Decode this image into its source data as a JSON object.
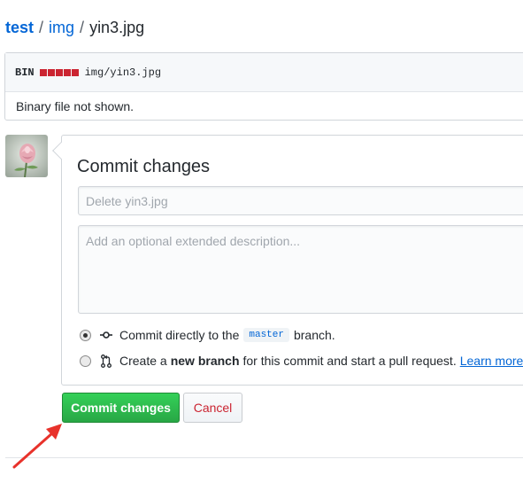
{
  "breadcrumb": {
    "root": "test",
    "folder": "img",
    "file": "yin3.jpg",
    "separator": "/"
  },
  "file": {
    "type_label": "BIN",
    "path": "img/yin3.jpg",
    "body_text": "Binary file not shown.",
    "diffstat_color": "#cb2431"
  },
  "commit": {
    "title": "Commit changes",
    "summary_placeholder": "Delete yin3.jpg",
    "description_placeholder": "Add an optional extended description...",
    "option_direct": {
      "before": "Commit directly to the",
      "branch": "master",
      "after": "branch.",
      "selected": true
    },
    "option_new": {
      "before": "Create a",
      "bold": "new branch",
      "after": "for this commit and start a pull request.",
      "link": "Learn more a",
      "selected": false
    },
    "submit_label": "Commit changes",
    "cancel_label": "Cancel"
  },
  "colors": {
    "link": "#0366d6",
    "primary": "#28a745",
    "danger": "#cb2431",
    "annotation_arrow": "#e8322b"
  }
}
